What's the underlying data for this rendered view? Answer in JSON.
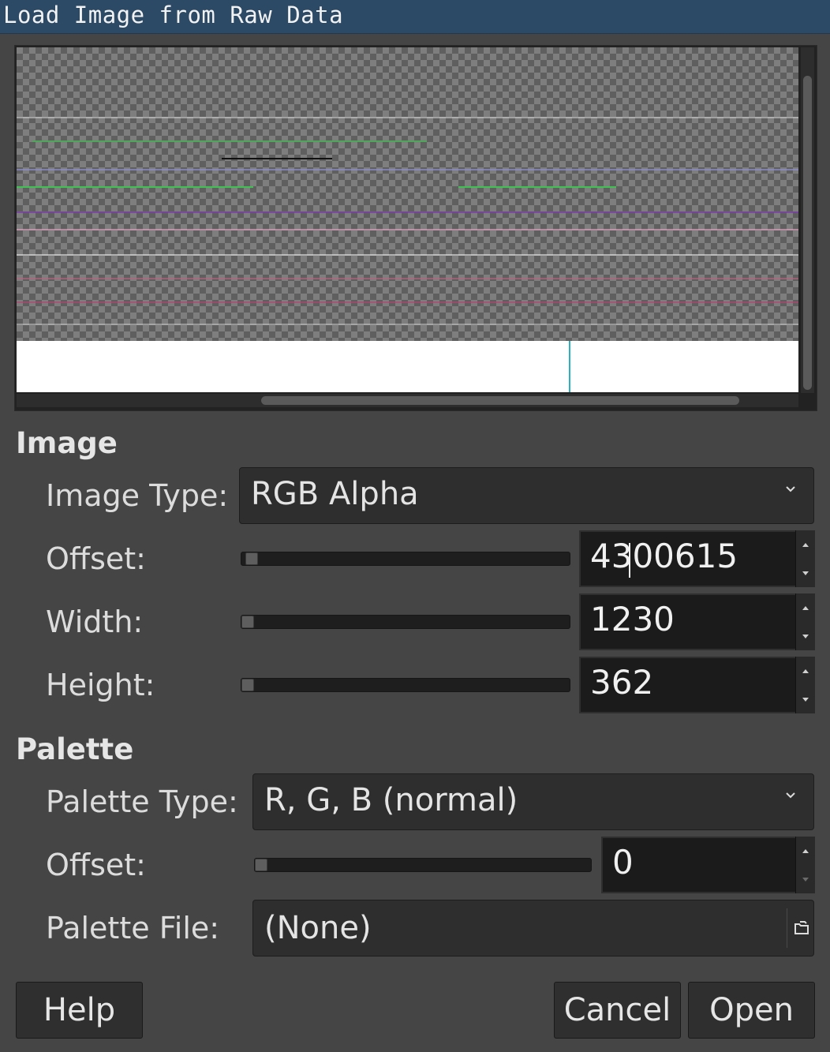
{
  "window": {
    "title": "Load Image from Raw Data"
  },
  "image_section": {
    "heading": "Image",
    "image_type_label": "Image Type:",
    "image_type_value": "RGB Alpha",
    "offset_label": "Offset:",
    "offset_value": "4300615",
    "width_label": "Width:",
    "width_value": "1230",
    "height_label": "Height:",
    "height_value": "362"
  },
  "palette_section": {
    "heading": "Palette",
    "palette_type_label": "Palette Type:",
    "palette_type_value": "R, G, B (normal)",
    "offset_label": "Offset:",
    "offset_value": "0",
    "palette_file_label": "Palette File:",
    "palette_file_value": "(None)"
  },
  "buttons": {
    "help": "Help",
    "cancel": "Cancel",
    "open": "Open"
  },
  "icons": {
    "combo": "chevron-down-icon",
    "spin_up": "spin-up-icon",
    "spin_down": "spin-down-icon",
    "file": "file-open-icon"
  },
  "colors": {
    "titlebar": "#2c4a66",
    "dialog_bg": "#454545",
    "field_bg": "#1b1b1b",
    "preview_cursor": "#2ab2c0"
  }
}
